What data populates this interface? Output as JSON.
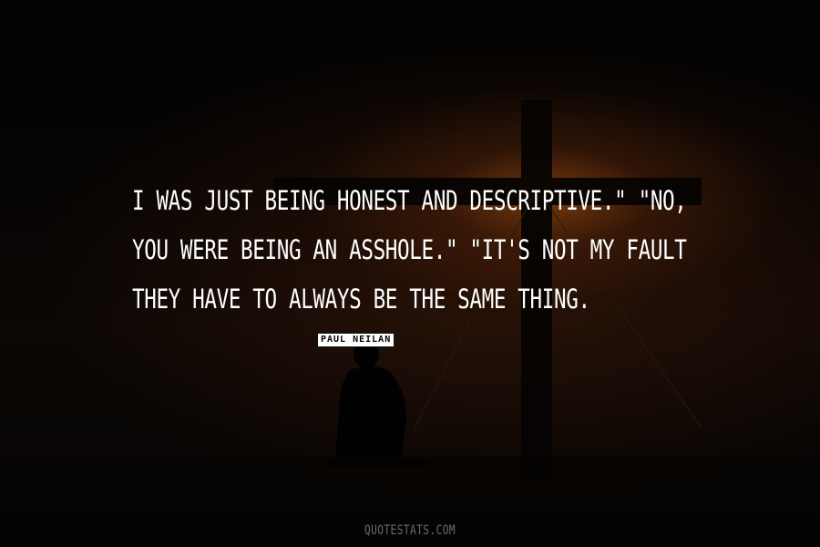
{
  "quote": {
    "lines": [
      "I was just being honest and descriptive.\" \"No,",
      "you were being an asshole.\" \"It's not my fault",
      "they have to always be the same thing."
    ]
  },
  "author": "Paul Neilan",
  "watermark": "QUOTESTATS.COM",
  "colors": {
    "text": "#ffffff",
    "glow": "#be5f14",
    "background": "#000000"
  }
}
